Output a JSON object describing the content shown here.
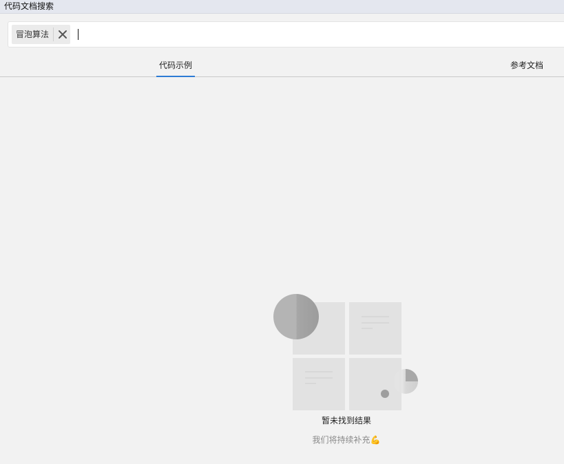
{
  "window": {
    "title": "代码文档搜索"
  },
  "search": {
    "tag_label": "冒泡算法",
    "value": "",
    "placeholder": ""
  },
  "tabs": [
    {
      "label": "代码示例",
      "active": true
    },
    {
      "label": "参考文档",
      "active": false
    }
  ],
  "empty_state": {
    "title": "暂未找到结果",
    "subtitle": "我们将持续补充💪"
  },
  "colors": {
    "accent": "#2c7bd4",
    "titlebar": "#e4e7ef",
    "background": "#f2f2f2"
  },
  "icons": {
    "tag_close": "close-icon",
    "empty": "empty-results-illustration"
  }
}
